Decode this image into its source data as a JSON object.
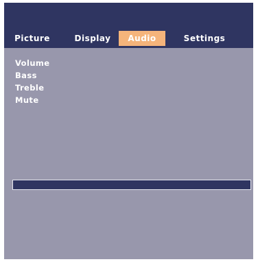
{
  "tabs": [
    {
      "label": "Picture"
    },
    {
      "label": "Display"
    },
    {
      "label": "Audio",
      "active": true
    },
    {
      "label": "Settings"
    }
  ],
  "menu": {
    "items": [
      {
        "label": "Volume"
      },
      {
        "label": "Bass"
      },
      {
        "label": "Treble"
      },
      {
        "label": "Mute"
      }
    ]
  },
  "status": {
    "text": ""
  },
  "colors": {
    "header": "#2f3561",
    "panel": "#9897ac",
    "active_tab": "#f5b47b",
    "text": "#ffffff"
  }
}
